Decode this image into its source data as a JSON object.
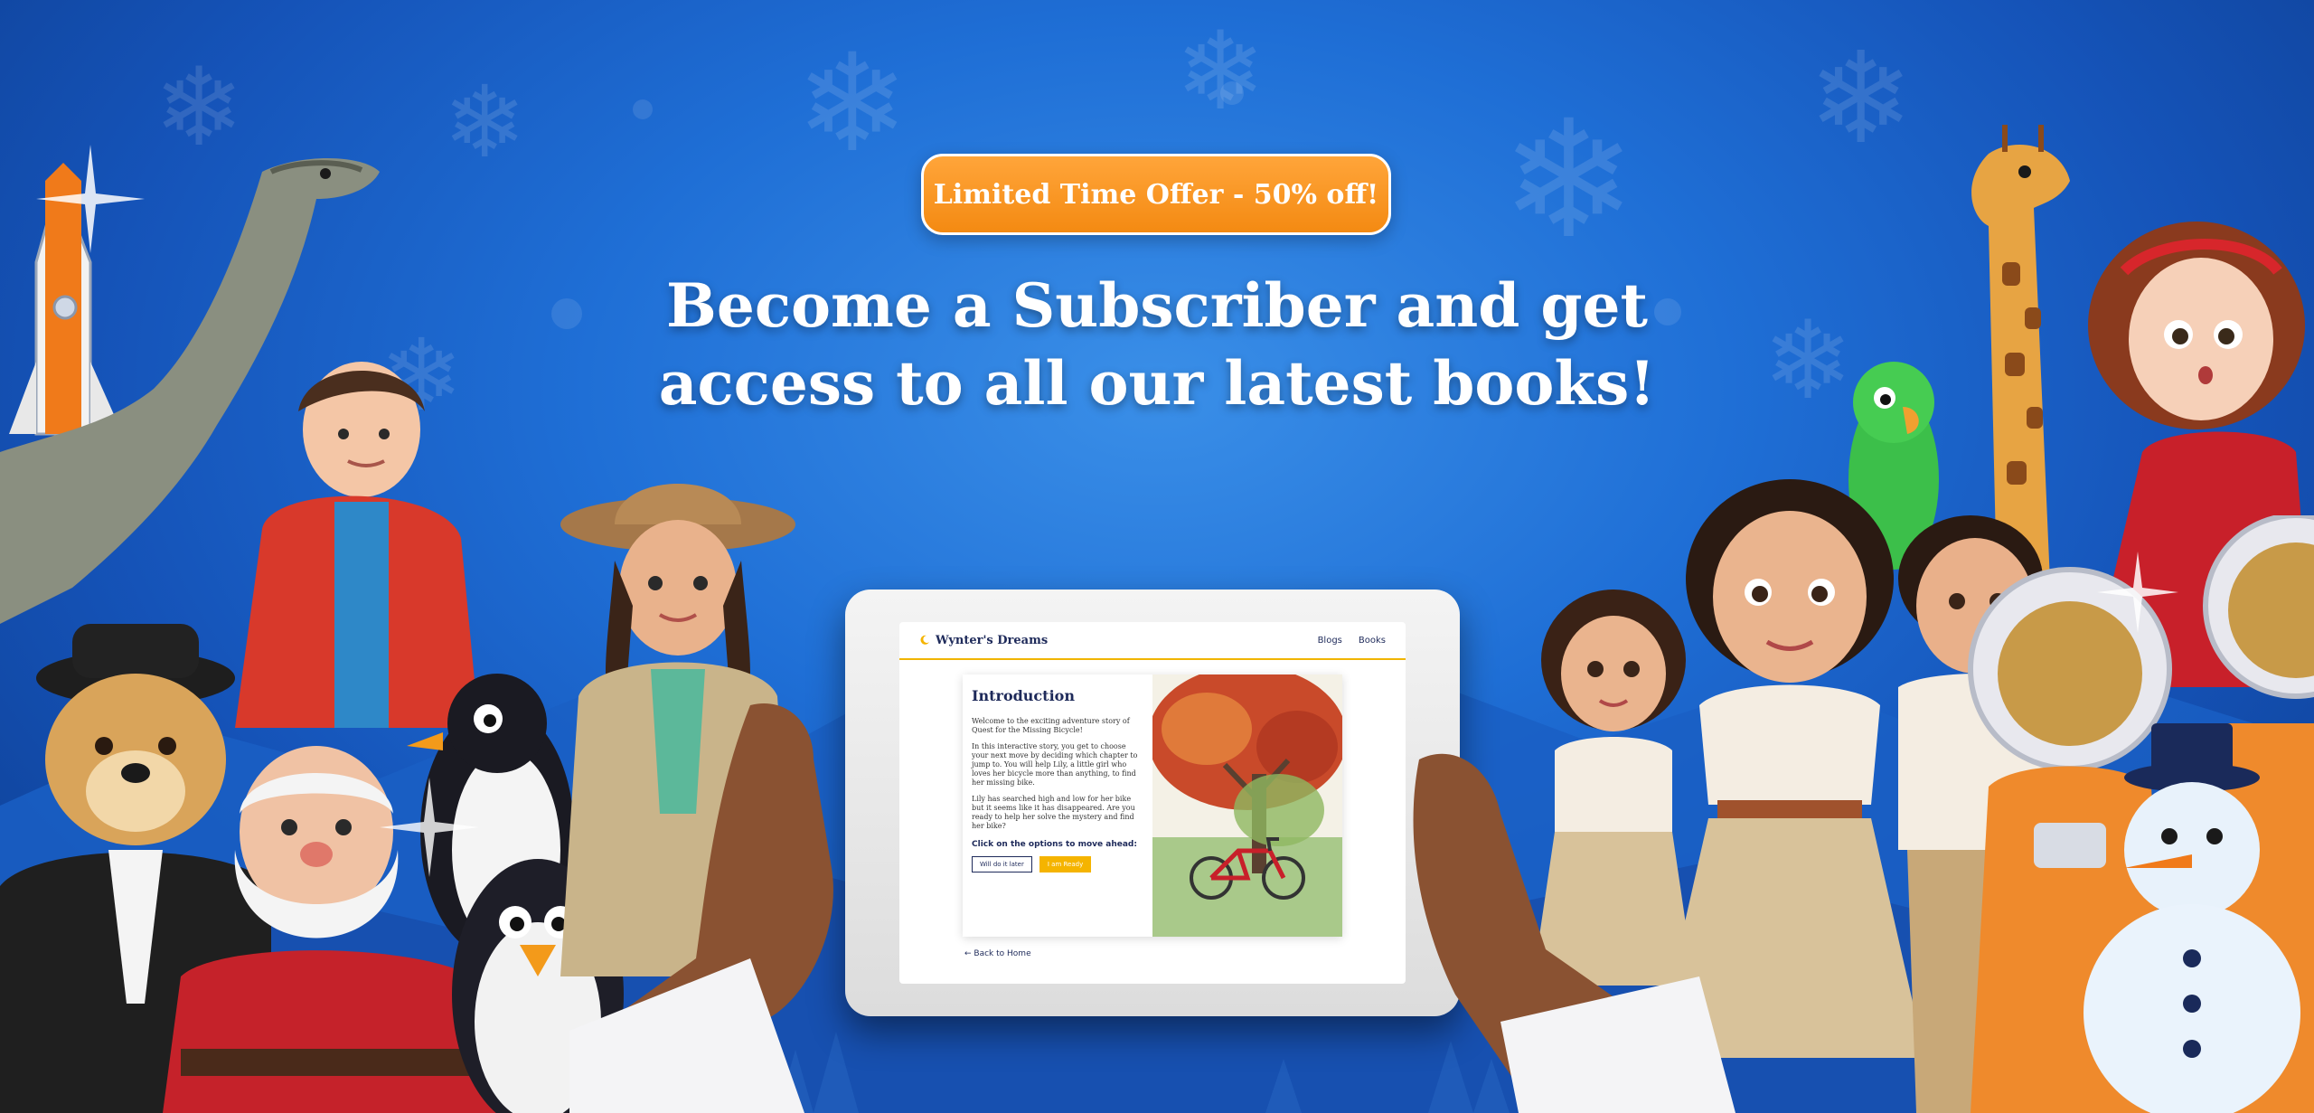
{
  "offer": {
    "label": "Limited Time Offer - 50% off!"
  },
  "headline": {
    "line1": "Become a Subscriber and get",
    "line2": "access to all our latest books!"
  },
  "tablet_app": {
    "brand": "Wynter's Dreams",
    "nav": [
      "Blogs",
      "Books"
    ],
    "story": {
      "title": "Introduction",
      "paragraphs": [
        "Welcome to the exciting adventure story of Quest for the Missing Bicycle!",
        "In this interactive story, you get to choose your next move by deciding which chapter to jump to. You will help Lily, a little girl who loves her bicycle more than anything, to find her missing bike.",
        "Lily has searched high and low for her bike but it seems like it has disappeared. Are you ready to help her solve the mystery and find her bike?"
      ],
      "prompt": "Click on the options to move ahead:",
      "choice_later": "Will do it later",
      "choice_ready": "I am Ready"
    },
    "back_link": "Back to Home"
  },
  "colors": {
    "background": "#1f6fd6",
    "accent_orange": "#f48a12",
    "brand_navy": "#1e2a5a",
    "app_yellow": "#f5b400"
  },
  "icons": [
    "moon-icon",
    "arrow-left-icon"
  ]
}
